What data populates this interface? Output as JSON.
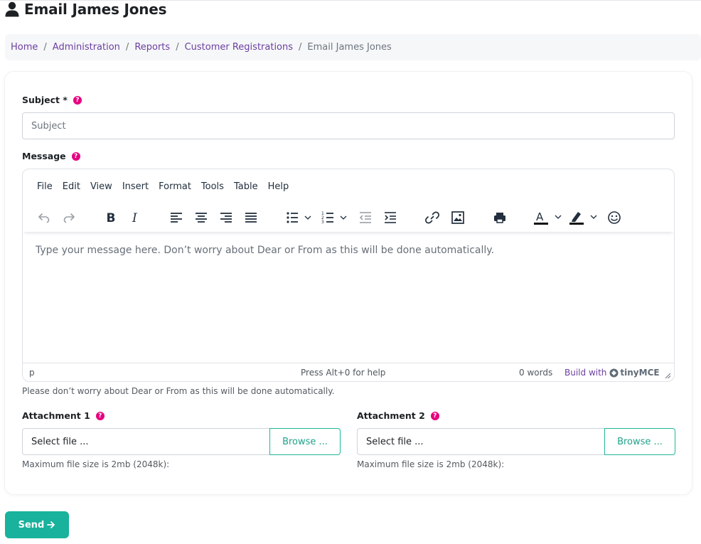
{
  "page": {
    "title": "Email James Jones",
    "title_icon": "user-icon"
  },
  "breadcrumb": {
    "items": [
      "Home",
      "Administration",
      "Reports",
      "Customer Registrations"
    ],
    "separator": "/",
    "current": "Email James Jones"
  },
  "form": {
    "subject_label": "Subject *",
    "subject_placeholder": "Subject",
    "subject_value": "",
    "message_label": "Message",
    "help_glyph": "?",
    "message_hint": "Please don’t worry about Dear or From as this will be done automatically."
  },
  "editor": {
    "menu": [
      "File",
      "Edit",
      "View",
      "Insert",
      "Format",
      "Tools",
      "Table",
      "Help"
    ],
    "toolbar_icons": [
      "undo-icon",
      "redo-icon",
      "bold-icon",
      "italic-icon",
      "align-left-icon",
      "align-center-icon",
      "align-right-icon",
      "align-justify-icon",
      "bullet-list-icon",
      "numbered-list-icon",
      "outdent-icon",
      "indent-icon",
      "link-icon",
      "image-icon",
      "print-icon",
      "text-color-icon",
      "highlight-color-icon",
      "emoticons-icon"
    ],
    "placeholder": "Type your message here. Don’t worry about Dear or From as this will be done automatically.",
    "status_path": "p",
    "status_help": "Press Alt+0 for help",
    "word_count": "0 words",
    "branding_prefix": "Build with",
    "branding_name": "tinyMCE"
  },
  "attachments": [
    {
      "label": "Attachment 1",
      "placeholder": "Select file ...",
      "browse_label": "Browse ...",
      "hint": "Maximum file size is 2mb (2048k):"
    },
    {
      "label": "Attachment 2",
      "placeholder": "Select file ...",
      "browse_label": "Browse ...",
      "hint": "Maximum file size is 2mb (2048k):"
    }
  ],
  "actions": {
    "send_label": "Send",
    "send_icon": "arrow-right-icon"
  },
  "colors": {
    "brand_accent": "#19b29c",
    "link": "#6b3fa0",
    "help_badge": "#e6007e"
  }
}
